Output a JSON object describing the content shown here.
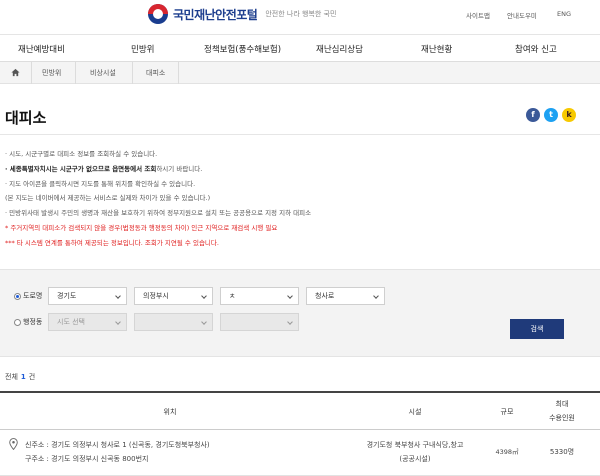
{
  "header": {
    "logo_text": "국민재난안전포털",
    "logo_sub": "안전한 나라 행복한 국민",
    "util_links": [
      "사이트맵",
      "안내도우미",
      "ENG"
    ]
  },
  "gnb": [
    "재난예방대비",
    "민방위",
    "정책보험(풍수해보험)",
    "재난심리상담",
    "재난현황",
    "참여와 신고"
  ],
  "breadcrumb": [
    "민방위",
    "비상시설",
    "대피소"
  ],
  "page_title": "대피소",
  "share": {
    "facebook": "f",
    "twitter": "t",
    "kakao": "k"
  },
  "notes": [
    {
      "text": "· 시도, 시군구별로 대피소 정보를 조회하실 수 있습니다.",
      "style": "normal"
    },
    {
      "bold": "· 세종특별자치시는 시군구가 없으므로 읍면동에서 조회",
      "text": "하시기 바랍니다.",
      "style": "mixed"
    },
    {
      "text": "· 지도 아이콘을 클릭하시면 지도를 통해 위치를 확인하실 수 있습니다.",
      "style": "normal"
    },
    {
      "text": "  (본 지도는 네이버에서 제공하는 서비스로 실제와 차이가 있을 수 있습니다.)",
      "style": "normal"
    },
    {
      "text": "· 민방위사태 발생시 주민의 생명과 재산을 보호하기 위하여 정부지원으로 설치 또는 공공용으로 지정 지하 대피소",
      "style": "normal"
    },
    {
      "text": "* 주거지역의 대피소가 검색되지 않을 경우(법정동과 행정동의 차이) 인근 지역으로 재검색 시행 필요",
      "style": "red"
    },
    {
      "text": "*** 타 시스템 연계를 통하여 제공되는 정보입니다. 조회가 지연될 수 있습니다.",
      "style": "red"
    }
  ],
  "search": {
    "road_label": "도로명",
    "admin_label": "행정동",
    "road_selects": [
      "경기도",
      "의정부시",
      "ㅊ",
      "청사로"
    ],
    "admin_selects": [
      "시도 선택",
      "",
      ""
    ],
    "button": "검색"
  },
  "count": {
    "prefix": "전체",
    "value": "1",
    "suffix": "건"
  },
  "table": {
    "headers": {
      "location": "위치",
      "facility": "시설",
      "size": "규모",
      "capacity_line1": "최대",
      "capacity_line2": "수용인원"
    },
    "rows": [
      {
        "new_addr": "신주소 : 경기도 의정부시 청사로 1 (신곡동, 경기도청북부청사)",
        "old_addr": "구주소 : 경기도 의정부시 신곡동 800번지",
        "facility_line1": "경기도청 북부청사 구내식당,창고",
        "facility_line2": "(공공시설)",
        "size": "4398㎡",
        "capacity": "5330명"
      }
    ]
  },
  "colors": {
    "accent": "#1e5bd7",
    "button": "#1f3a7a",
    "warning": "#e02020"
  }
}
